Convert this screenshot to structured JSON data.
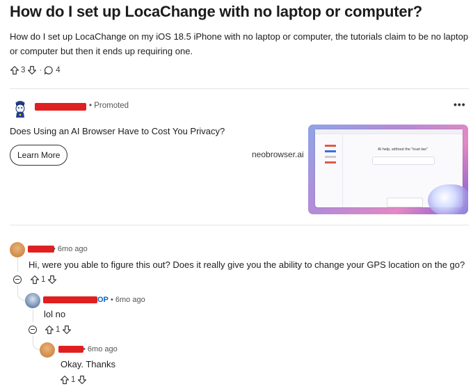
{
  "post": {
    "title": "How do I set up LocaChange with no laptop or computer?",
    "body": "How do I set up LocaChange on my iOS 18.5 iPhone with no laptop or computer, the tutorials claim to be no laptop or computer but then it ends up requiring one.",
    "upvotes": "3",
    "comments": "4",
    "separator": "·"
  },
  "ad": {
    "promoted_label": "• Promoted",
    "more_label": "•••",
    "headline": "Does Using an AI Browser Have to Cost You Privacy?",
    "cta_label": "Learn More",
    "domain": "neobrowser.ai",
    "image_tagline": "AI help, without the \"trust tax\"",
    "avatar_icon": "mascot-avatar-icon"
  },
  "comments": [
    {
      "time": "• 6mo ago",
      "text": "Hi, were you able to figure this out? Does it really give you the ability to change your GPS location on the go?",
      "votes": "1"
    },
    {
      "op_label": "OP",
      "time": "• 6mo ago",
      "text": "lol no",
      "votes": "1"
    },
    {
      "time": "• 6mo ago",
      "text": "Okay. Thanks",
      "votes": "1"
    }
  ],
  "colors": {
    "redaction": "#e02020",
    "op": "#0a66c2",
    "divider": "#e1e4e6"
  }
}
